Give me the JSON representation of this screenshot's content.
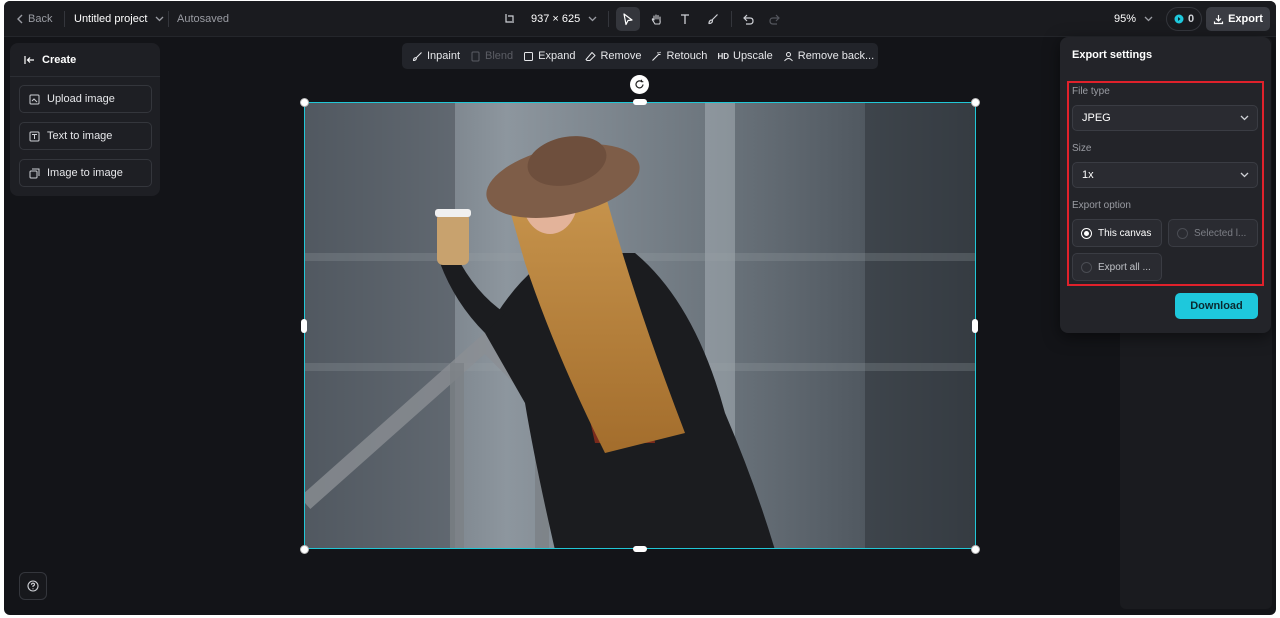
{
  "topbar": {
    "back_label": "Back",
    "project_name": "Untitled project",
    "save_status": "Autosaved",
    "canvas_size": "937 × 625",
    "zoom": "95%",
    "credits": "0",
    "export_label": "Export"
  },
  "left_panel": {
    "title": "Create",
    "items": [
      {
        "label": "Upload image",
        "icon": "upload-image-icon"
      },
      {
        "label": "Text to image",
        "icon": "text-to-image-icon"
      },
      {
        "label": "Image to image",
        "icon": "image-to-image-icon"
      }
    ]
  },
  "edit_toolbar": {
    "items": [
      {
        "label": "Inpaint",
        "enabled": true
      },
      {
        "label": "Blend",
        "enabled": false
      },
      {
        "label": "Expand",
        "enabled": true
      },
      {
        "label": "Remove",
        "enabled": true
      },
      {
        "label": "Retouch",
        "enabled": true
      },
      {
        "label": "Upscale",
        "badge": "HD",
        "enabled": true
      },
      {
        "label": "Remove back...",
        "enabled": true
      }
    ]
  },
  "export_settings": {
    "title": "Export settings",
    "file_type_label": "File type",
    "file_type_value": "JPEG",
    "size_label": "Size",
    "size_value": "1x",
    "export_option_label": "Export option",
    "options": [
      {
        "label": "This canvas",
        "selected": true
      },
      {
        "label": "Selected l...",
        "selected": false
      },
      {
        "label": "Export all ...",
        "selected": false
      }
    ],
    "download_label": "Download"
  },
  "colors": {
    "accent": "#1ec8dc",
    "selection": "#21c7d6",
    "highlight": "#e0212b",
    "background": "#131418"
  }
}
